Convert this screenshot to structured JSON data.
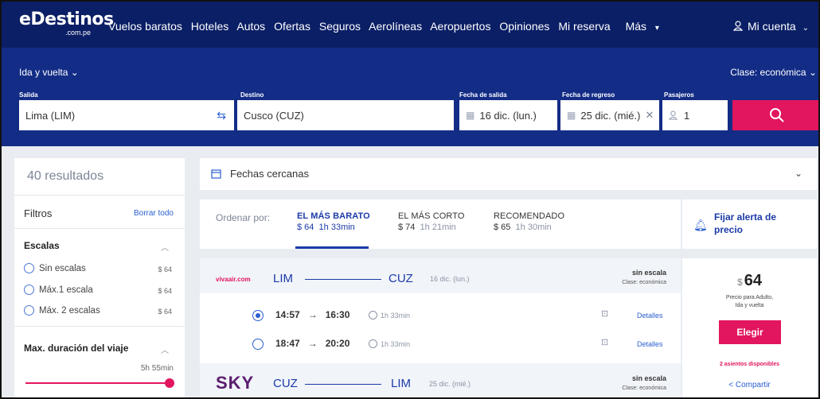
{
  "nav": {
    "logo": "eDestinos",
    "logo_sub": ".com.pe",
    "links": [
      "Vuelos baratos",
      "Hoteles",
      "Autos",
      "Ofertas",
      "Seguros",
      "Aerolíneas",
      "Aeropuertos",
      "Opiniones",
      "Mi reserva"
    ],
    "more": "Más",
    "account": "Mi cuenta"
  },
  "search": {
    "trip_type": "Ida y vuelta",
    "cabin_class": "Clase: económica",
    "labels": {
      "origin": "Salida",
      "destination": "Destino",
      "depart": "Fecha de salida",
      "return": "Fecha de regreso",
      "passengers": "Pasajeros"
    },
    "origin": "Lima (LIM)",
    "destination": "Cusco (CUZ)",
    "depart_date": "16 dic. (lun.)",
    "return_date": "25 dic. (mié.)",
    "passengers": "1"
  },
  "sidebar": {
    "results": "40 resultados",
    "filters": "Filtros",
    "clear_all": "Borrar todo",
    "stops_title": "Escalas",
    "stops": [
      {
        "label": "Sin escalas",
        "price": "$ 64"
      },
      {
        "label": "Máx.1 escala",
        "price": "$ 64"
      },
      {
        "label": "Máx. 2 escalas",
        "price": "$ 64"
      }
    ],
    "duration_title": "Max. duración del viaje",
    "duration_value": "5h 55min",
    "duration_level": 1.0
  },
  "nearby_dates": "Fechas cercanas",
  "sort": {
    "label": "Ordenar por:",
    "options": [
      {
        "title": "EL MÁS BARATO",
        "price": "$ 64",
        "time": "1h 33min"
      },
      {
        "title": "EL MÁS CORTO",
        "price": "$ 74",
        "time": "1h 21min"
      },
      {
        "title": "RECOMENDADO",
        "price": "$ 65",
        "time": "1h 30min"
      }
    ]
  },
  "alert": "Fijar alerta de precio",
  "result": {
    "outbound": {
      "airline": "vivaair.com",
      "from": "LIM",
      "to": "CUZ",
      "date": "16 dic. (lun.)",
      "stops": "sin escala",
      "cabin": "Clase: económica",
      "flights": [
        {
          "dep": "14:57",
          "arr": "16:30",
          "duration": "1h 33min",
          "details": "Detalles"
        },
        {
          "dep": "18:47",
          "arr": "20:20",
          "duration": "1h 33min",
          "details": "Detalles"
        }
      ]
    },
    "inbound": {
      "airline": "SKY",
      "from": "CUZ",
      "to": "LIM",
      "date": "25 dic. (mié.)",
      "stops": "sin escala",
      "cabin": "Clase: económica"
    },
    "price_currency": "$",
    "price": "64",
    "price_note_1": "Precio para Adulto,",
    "price_note_2": "Ida y vuelta",
    "choose": "Elegir",
    "seats": "2 asientos disponibles",
    "share": "Compartir"
  },
  "colors": {
    "nav_bg": "#0b1f66",
    "search_bg": "#132c86",
    "accent": "#e2155f",
    "link": "#2a5fd0"
  }
}
